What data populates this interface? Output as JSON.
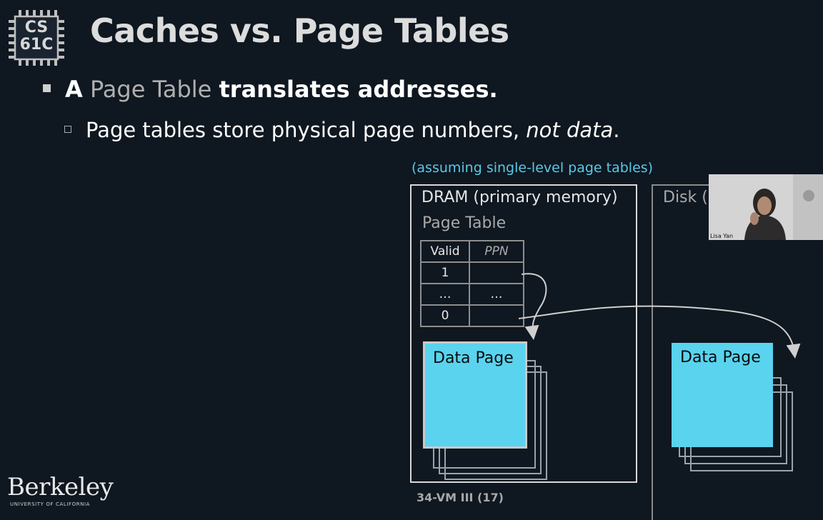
{
  "logo": {
    "line1": "CS",
    "line2": "61C"
  },
  "slide": {
    "title": "Caches vs. Page Tables",
    "bullet1": {
      "a": "A",
      "page_table": "Page Table",
      "rest": "translates addresses."
    },
    "bullet2": {
      "text": "Page tables store physical page numbers, ",
      "emphasis": "not data",
      "end": "."
    },
    "assumption": "(assuming single-level page tables)"
  },
  "diagram": {
    "dram_label": "DRAM (primary memory)",
    "page_table_label": "Page Table",
    "table": {
      "headers": [
        "Valid",
        "PPN"
      ],
      "rows": [
        [
          "1",
          ""
        ],
        [
          "…",
          "…"
        ],
        [
          "0",
          ""
        ]
      ]
    },
    "dram_page_label": "Data Page",
    "disk_label": "Disk (s",
    "disk_page_label": "Data Page"
  },
  "footer": {
    "slide_ref": "34-VM III (17)"
  },
  "branding": {
    "name": "Berkeley",
    "sub": "UNIVERSITY OF CALIFORNIA"
  },
  "video": {
    "name": "Lisa Yan"
  },
  "colors": {
    "accent": "#59c9e6",
    "page_fill": "#5ad3ef",
    "background": "#0f1720"
  }
}
